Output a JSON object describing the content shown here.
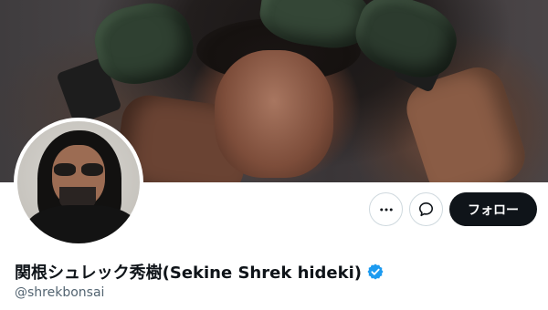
{
  "profile": {
    "display_name": "関根シュレック秀樹(Sekine Shrek hideki)",
    "handle": "@shrekbonsai",
    "verified": true
  },
  "actions": {
    "more_icon": "more-horizontal-icon",
    "message_icon": "message-bubble-icon",
    "follow_label": "フォロー"
  },
  "colors": {
    "follow_button_bg": "#0f1419",
    "verified_badge": "#1d9bf0",
    "handle_text": "#536471"
  }
}
